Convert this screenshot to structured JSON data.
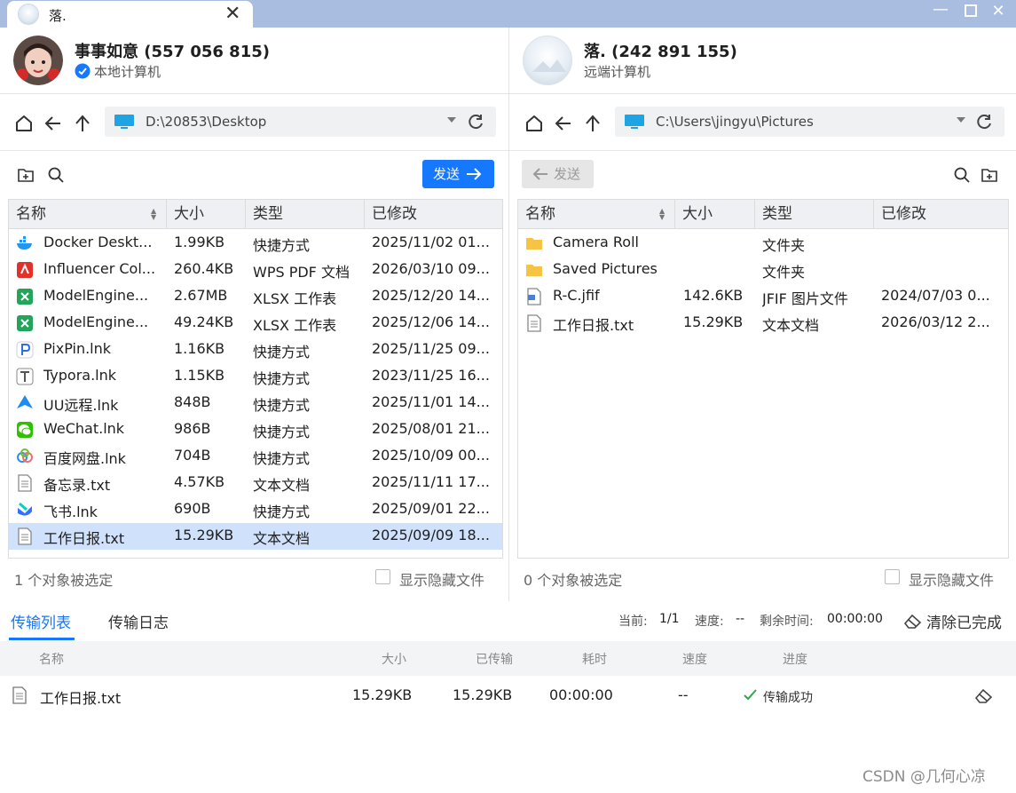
{
  "window": {
    "tab_title": "落.",
    "close_glyph": "✕",
    "minimize_glyph": "—",
    "maximize_glyph": "☐",
    "window_close_glyph": "✕"
  },
  "local": {
    "name": "事事如意 (557 056 815)",
    "subtitle": "本地计算机",
    "path": "D:\\20853\\Desktop",
    "send_label": "发送",
    "status": "1 个对象被选定",
    "show_hidden": "显示隐藏文件",
    "columns": [
      "名称",
      "大小",
      "类型",
      "已修改"
    ],
    "files": [
      {
        "name": "Docker Deskt...",
        "size": "1.99KB",
        "type": "快捷方式",
        "modified": "2025/11/02 01...",
        "icon": "docker-icon",
        "color": "#2496ed"
      },
      {
        "name": "Influencer Col...",
        "size": "260.4KB",
        "type": "WPS PDF 文档",
        "modified": "2026/03/10 09...",
        "icon": "pdf-icon",
        "color": "#e0312b"
      },
      {
        "name": "ModelEngine...",
        "size": "2.67MB",
        "type": "XLSX 工作表",
        "modified": "2025/12/20 14...",
        "icon": "xlsx-icon",
        "color": "#22a55b"
      },
      {
        "name": "ModelEngine...",
        "size": "49.24KB",
        "type": "XLSX 工作表",
        "modified": "2025/12/06 14...",
        "icon": "xlsx-icon",
        "color": "#22a55b"
      },
      {
        "name": "PixPin.lnk",
        "size": "1.16KB",
        "type": "快捷方式",
        "modified": "2025/11/25 09...",
        "icon": "pixpin-icon",
        "color": "#2f6fde"
      },
      {
        "name": "Typora.lnk",
        "size": "1.15KB",
        "type": "快捷方式",
        "modified": "2023/11/25 16...",
        "icon": "typora-icon",
        "color": "#555555"
      },
      {
        "name": "UU远程.lnk",
        "size": "848B",
        "type": "快捷方式",
        "modified": "2025/11/01 14...",
        "icon": "uu-remote-icon",
        "color": "#1d8bf1"
      },
      {
        "name": "WeChat.lnk",
        "size": "986B",
        "type": "快捷方式",
        "modified": "2025/08/01 21...",
        "icon": "wechat-icon",
        "color": "#2dc100"
      },
      {
        "name": "百度网盘.lnk",
        "size": "704B",
        "type": "快捷方式",
        "modified": "2025/10/09 00...",
        "icon": "baidu-netdisk-icon",
        "color": "#2c8cf4"
      },
      {
        "name": "备忘录.txt",
        "size": "4.57KB",
        "type": "文本文档",
        "modified": "2025/11/11 17...",
        "icon": "text-file-icon",
        "color": "#888888"
      },
      {
        "name": "飞书.lnk",
        "size": "690B",
        "type": "快捷方式",
        "modified": "2025/09/01 22...",
        "icon": "feishu-icon",
        "color": "#3370ff"
      },
      {
        "name": "工作日报.txt",
        "size": "15.29KB",
        "type": "文本文档",
        "modified": "2025/09/09 18...",
        "icon": "text-file-icon",
        "color": "#888888",
        "selected": true
      }
    ]
  },
  "remote": {
    "name": "落. (242 891 155)",
    "subtitle": "远端计算机",
    "path": "C:\\Users\\jingyu\\Pictures",
    "send_label": "发送",
    "status": "0 个对象被选定",
    "show_hidden": "显示隐藏文件",
    "columns": [
      "名称",
      "大小",
      "类型",
      "已修改"
    ],
    "files": [
      {
        "name": "Camera Roll",
        "size": "",
        "type": "文件夹",
        "modified": "",
        "icon": "folder-icon",
        "color": "#f5c445"
      },
      {
        "name": "Saved Pictures",
        "size": "",
        "type": "文件夹",
        "modified": "",
        "icon": "folder-icon",
        "color": "#f5c445"
      },
      {
        "name": "R-C.jfif",
        "size": "142.6KB",
        "type": "JFIF 图片文件",
        "modified": "2024/07/03 0...",
        "icon": "image-file-icon",
        "color": "#4a7fd4"
      },
      {
        "name": "工作日报.txt",
        "size": "15.29KB",
        "type": "文本文档",
        "modified": "2026/03/12 2...",
        "icon": "text-file-icon",
        "color": "#888888"
      }
    ]
  },
  "transfer": {
    "tabs": [
      "传输列表",
      "传输日志"
    ],
    "current_label": "当前:",
    "current_value": "1/1",
    "speed_label": "速度:",
    "speed_value": "--",
    "remaining_label": "剩余时间:",
    "remaining_value": "00:00:00",
    "clear_label": "清除已完成",
    "columns": [
      "名称",
      "大小",
      "已传输",
      "耗时",
      "速度",
      "进度"
    ],
    "rows": [
      {
        "name": "工作日报.txt",
        "size": "15.29KB",
        "transferred": "15.29KB",
        "elapsed": "00:00:00",
        "speed": "--",
        "progress": "传输成功"
      }
    ]
  },
  "watermark": "CSDN @几何心凉"
}
